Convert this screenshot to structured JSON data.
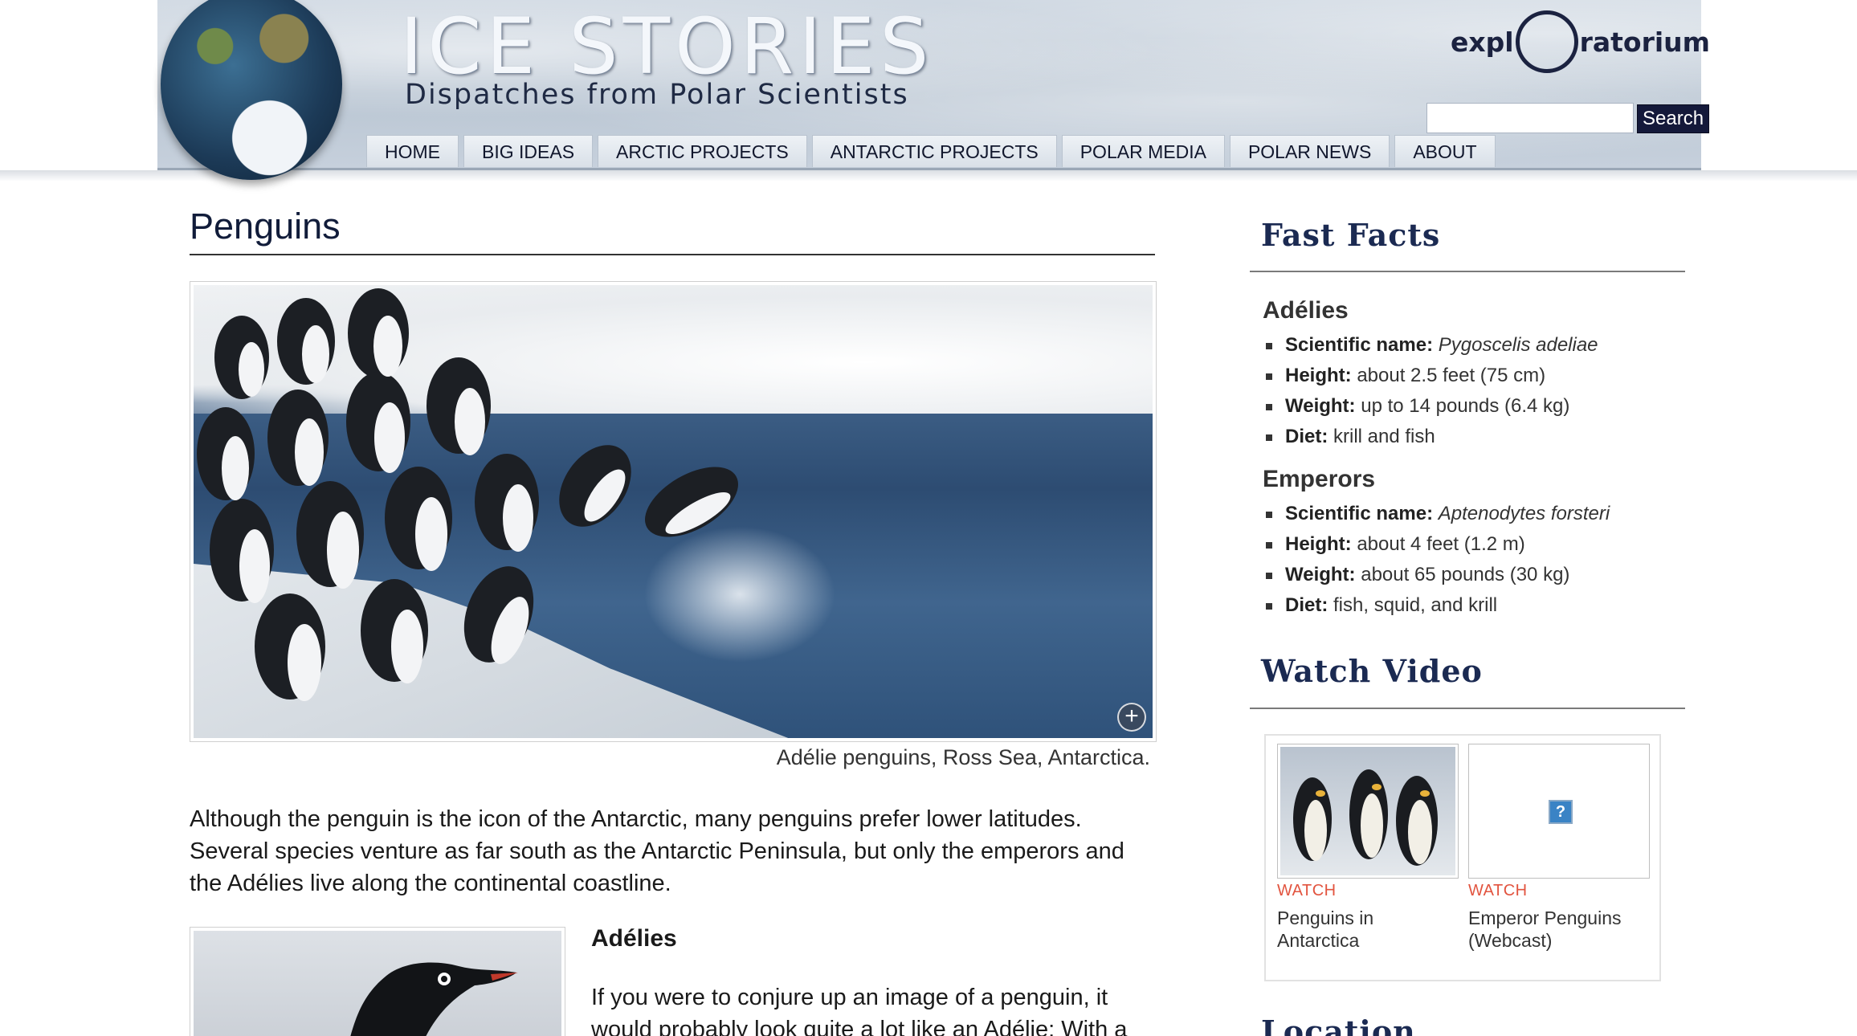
{
  "header": {
    "site_title": "ICE STORIES",
    "site_subtitle": "Dispatches from Polar Scientists",
    "brand_left": "expl",
    "brand_right": "ratorium",
    "search_button": "Search",
    "search_placeholder": ""
  },
  "nav": [
    "HOME",
    "BIG IDEAS",
    "ARCTIC PROJECTS",
    "ANTARCTIC PROJECTS",
    "POLAR MEDIA",
    "POLAR NEWS",
    "ABOUT"
  ],
  "main": {
    "title": "Penguins",
    "hero_caption": "Adélie penguins, Ross Sea, Antarctica.",
    "intro": "Although the penguin is the icon of the Antarctic, many penguins prefer lower latitudes. Several species venture as far south as the Antarctic Peninsula, but only the emperors and the Adélies live along the continental coastline.",
    "section_heading": "Adélies",
    "section_text": "If you were to conjure up an image of a penguin, it would probably look quite a lot like an Adélie: With a"
  },
  "sidebar": {
    "fast_facts_heading": "Fast Facts",
    "adelies": {
      "name": "Adélies",
      "facts": [
        {
          "label": "Scientific name:",
          "value": "Pygoscelis adeliae"
        },
        {
          "label": "Height:",
          "value": "about 2.5 feet (75 cm)"
        },
        {
          "label": "Weight:",
          "value": "up to 14 pounds (6.4 kg)"
        },
        {
          "label": "Diet:",
          "value": "krill and fish"
        }
      ]
    },
    "emperors": {
      "name": "Emperors",
      "facts": [
        {
          "label": "Scientific name:",
          "value": "Aptenodytes forsteri"
        },
        {
          "label": "Height:",
          "value": "about 4 feet (1.2 m)"
        },
        {
          "label": "Weight:",
          "value": "about 65 pounds (30 kg)"
        },
        {
          "label": "Diet:",
          "value": "fish, squid, and krill"
        }
      ]
    },
    "watch_video_heading": "Watch Video",
    "videos": [
      {
        "watch": "WATCH",
        "title_line1": "Penguins in",
        "title_line2": "Antarctica"
      },
      {
        "watch": "WATCH",
        "title_line1": "Emperor Penguins",
        "title_line2": "(Webcast)"
      }
    ],
    "missing_image_glyph": "?",
    "next_heading": "Location"
  },
  "colors": {
    "nav_text": "#10162c",
    "heading_navy": "#1b2a52",
    "watch_red": "#e2543f",
    "search_button_bg": "#14193a"
  }
}
